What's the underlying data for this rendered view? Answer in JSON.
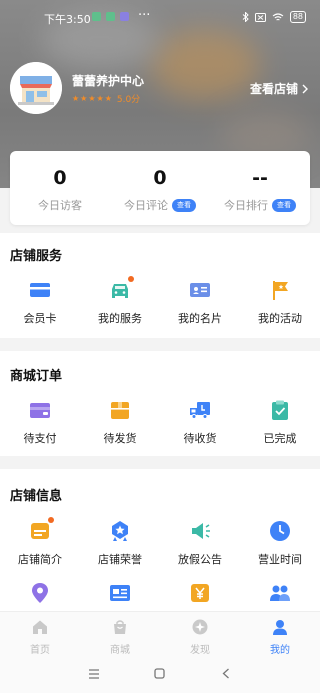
{
  "status_bar": {
    "time": "下午3:50",
    "dots": "···",
    "battery": "88"
  },
  "store": {
    "name": "蕾蕾养护中心",
    "rating": "5.0分",
    "stars": 5,
    "view_store_label": "查看店铺"
  },
  "stats": [
    {
      "value": "0",
      "label": "今日访客",
      "button": ""
    },
    {
      "value": "0",
      "label": "今日评论",
      "button": "查看"
    },
    {
      "value": "--",
      "label": "今日排行",
      "button": "查看"
    }
  ],
  "store_service": {
    "title": "店铺服务",
    "items": [
      {
        "label": "会员卡",
        "icon": "member-card-icon",
        "badge": false
      },
      {
        "label": "我的服务",
        "icon": "car-service-icon",
        "badge": true
      },
      {
        "label": "我的名片",
        "icon": "business-card-icon",
        "badge": false
      },
      {
        "label": "我的活动",
        "icon": "activity-flag-icon",
        "badge": false
      }
    ]
  },
  "mall_orders": {
    "title": "商城订单",
    "items": [
      {
        "label": "待支付",
        "icon": "wallet-icon"
      },
      {
        "label": "待发货",
        "icon": "package-icon"
      },
      {
        "label": "待收货",
        "icon": "delivery-truck-icon"
      },
      {
        "label": "已完成",
        "icon": "completed-clipboard-icon"
      }
    ]
  },
  "store_info": {
    "title": "店铺信息",
    "items": [
      {
        "label": "店铺简介",
        "icon": "store-intro-icon",
        "badge": true
      },
      {
        "label": "店铺荣誉",
        "icon": "honor-medal-icon",
        "badge": false
      },
      {
        "label": "放假公告",
        "icon": "megaphone-icon",
        "badge": false
      },
      {
        "label": "营业时间",
        "icon": "clock-icon",
        "badge": false
      }
    ],
    "partial_icons": [
      "location-pin-icon",
      "id-card-icon",
      "yuan-payment-icon",
      "staff-group-icon"
    ]
  },
  "tabbar": [
    {
      "label": "首页",
      "icon": "home-icon",
      "active": false
    },
    {
      "label": "商城",
      "icon": "shop-bag-icon",
      "active": false
    },
    {
      "label": "发现",
      "icon": "discover-compass-icon",
      "active": false
    },
    {
      "label": "我的",
      "icon": "profile-icon",
      "active": true
    }
  ],
  "colors": {
    "accent": "#3e82f7",
    "star": "#f28c28",
    "badge": "#f26a22"
  }
}
